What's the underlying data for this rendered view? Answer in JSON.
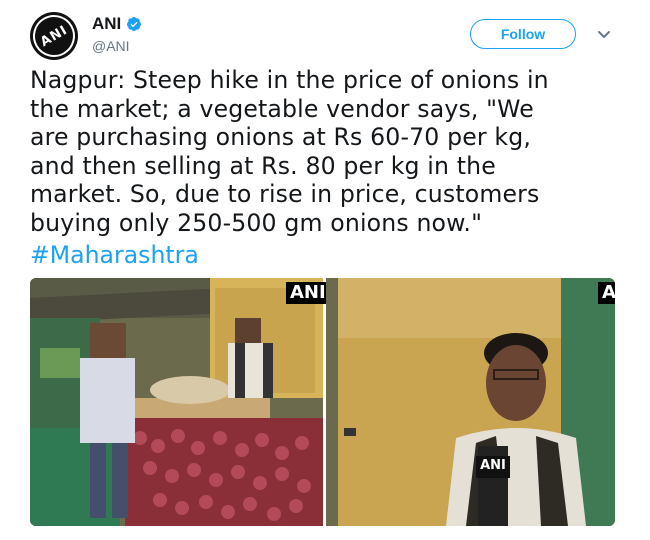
{
  "account": {
    "display_name": "ANI",
    "handle": "@ANI",
    "avatar_text": "ANI",
    "verified": true
  },
  "actions": {
    "follow_label": "Follow",
    "more_icon": "chevron-down-icon"
  },
  "tweet": {
    "text": "Nagpur: Steep hike in the price of onions in\nthe market; a vegetable vendor says, \"We\nare purchasing onions at Rs 60-70 per kg,\nand then selling at Rs. 80 per kg in the\nmarket. So, due to rise in price, customers\nbuying only 250-500 gm onions now.\"",
    "hashtag": "#Maharashtra"
  },
  "media": {
    "left_watermark": "ANI",
    "right_watermark": "A",
    "mic_label": "ANI"
  },
  "colors": {
    "accent": "#1da1f2",
    "text": "#14171a",
    "muted": "#657786"
  }
}
